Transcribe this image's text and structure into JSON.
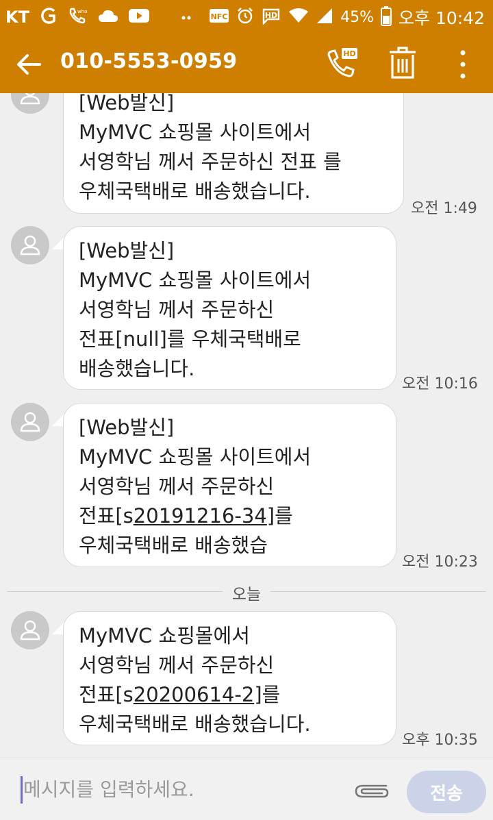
{
  "status_bar": {
    "carrier": "KT",
    "battery_percent": "45%",
    "time": "오후 10:42",
    "icons": [
      "g-signal-icon",
      "whowho-icon",
      "cloud-icon",
      "youtube-icon",
      "dots-icon",
      "nfc-icon",
      "alarm-icon",
      "hd-icon",
      "wifi-icon",
      "signal-icon",
      "battery-icon"
    ],
    "nfc_label": "NFC",
    "hd_label": "HD"
  },
  "header": {
    "title": "010-5553-0959",
    "accent_color": "#cf7f00",
    "call_hd_label": "HD"
  },
  "messages": [
    {
      "lines": [
        "[Web발신]",
        "MyMVC 쇼핑몰 사이트에서",
        "서영학님 께서 주문하신 전표 를",
        "우체국택배로 배송했습니다."
      ],
      "time": "오전 1:49"
    },
    {
      "lines": [
        "[Web발신]",
        "MyMVC 쇼핑몰 사이트에서",
        "서영학님 께서 주문하신",
        "전표[null]를 우체국택배로",
        "배송했습니다."
      ],
      "time": "오전 10:16"
    },
    {
      "lines": [
        "[Web발신]",
        "MyMVC 쇼핑몰 사이트에서",
        "서영학님 께서 주문하신"
      ],
      "line4_prefix": "전표[s",
      "line4_link": "20191216-34",
      "line4_suffix": "]를",
      "line5": "우체국택배로 배송했습",
      "time": "오전 10:23"
    },
    {
      "lines": [
        "MyMVC 쇼핑몰에서",
        "서영학님 께서 주문하신"
      ],
      "line3_prefix": "전표[s",
      "line3_link": "20200614-2",
      "line3_suffix": "]를",
      "line4": "우체국택배로 배송했습니다.",
      "time": "오후 10:35"
    }
  ],
  "date_divider": "오늘",
  "composer": {
    "placeholder": "메시지를 입력하세요.",
    "send_label": "전송"
  }
}
